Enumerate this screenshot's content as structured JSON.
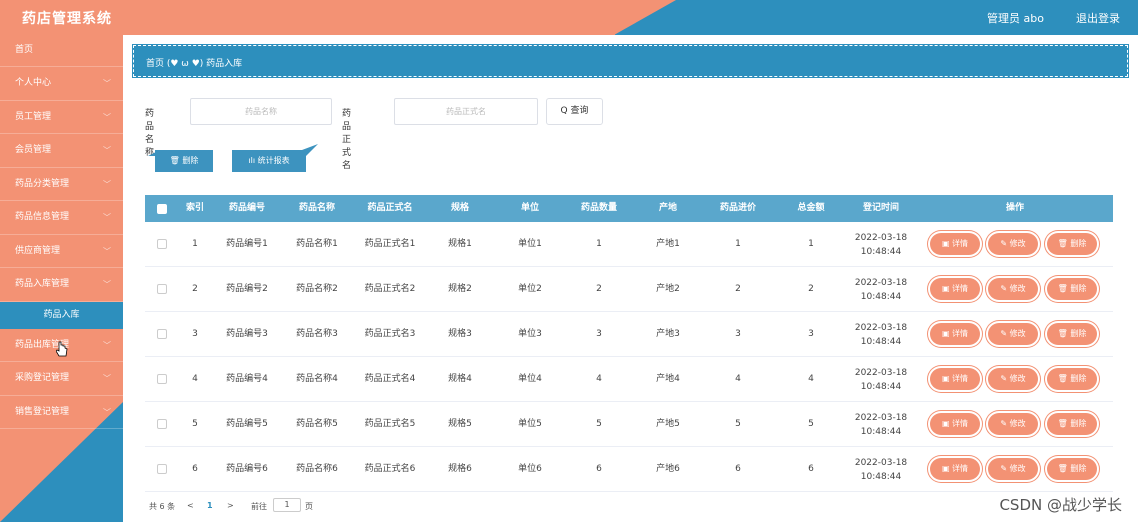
{
  "header": {
    "title": "药店管理系统",
    "user_label": "管理员 abo",
    "logout_label": "退出登录"
  },
  "sidebar": {
    "items": [
      {
        "label": "首页",
        "chevron": false
      },
      {
        "label": "个人中心",
        "chevron": true
      },
      {
        "label": "员工管理",
        "chevron": true
      },
      {
        "label": "会员管理",
        "chevron": true
      },
      {
        "label": "药品分类管理",
        "chevron": true
      },
      {
        "label": "药品信息管理",
        "chevron": true
      },
      {
        "label": "供应商管理",
        "chevron": true
      },
      {
        "label": "药品入库管理",
        "chevron": true
      },
      {
        "label": "药品入库",
        "sub": true
      },
      {
        "label": "药品出库管理",
        "chevron": true
      },
      {
        "label": "采购登记管理",
        "chevron": true
      },
      {
        "label": "销售登记管理",
        "chevron": true
      }
    ],
    "chevron_glyph": "﹀"
  },
  "breadcrumb": "首页 (♥ ω ♥) 药品入库",
  "search": {
    "name_label": "药品名称",
    "name_placeholder": "药品名称",
    "formal_label": "药品正式名",
    "formal_placeholder": "药品正式名",
    "query_label": "Q 查询"
  },
  "actions": {
    "delete_label": "🗑 删除",
    "report_label": "ılı 统计报表"
  },
  "table": {
    "headers": [
      "索引",
      "药品编号",
      "药品名称",
      "药品正式名",
      "规格",
      "单位",
      "药品数量",
      "产地",
      "药品进价",
      "总金额",
      "登记时间",
      "操作"
    ],
    "rows": [
      {
        "idx": "1",
        "code": "药品编号1",
        "name": "药品名称1",
        "formal": "药品正式名1",
        "spec": "规格1",
        "unit": "单位1",
        "qty": "1",
        "origin": "产地1",
        "price": "1",
        "total": "1",
        "date": "2022-03-18",
        "time": "10:48:44"
      },
      {
        "idx": "2",
        "code": "药品编号2",
        "name": "药品名称2",
        "formal": "药品正式名2",
        "spec": "规格2",
        "unit": "单位2",
        "qty": "2",
        "origin": "产地2",
        "price": "2",
        "total": "2",
        "date": "2022-03-18",
        "time": "10:48:44"
      },
      {
        "idx": "3",
        "code": "药品编号3",
        "name": "药品名称3",
        "formal": "药品正式名3",
        "spec": "规格3",
        "unit": "单位3",
        "qty": "3",
        "origin": "产地3",
        "price": "3",
        "total": "3",
        "date": "2022-03-18",
        "time": "10:48:44"
      },
      {
        "idx": "4",
        "code": "药品编号4",
        "name": "药品名称4",
        "formal": "药品正式名4",
        "spec": "规格4",
        "unit": "单位4",
        "qty": "4",
        "origin": "产地4",
        "price": "4",
        "total": "4",
        "date": "2022-03-18",
        "time": "10:48:44"
      },
      {
        "idx": "5",
        "code": "药品编号5",
        "name": "药品名称5",
        "formal": "药品正式名5",
        "spec": "规格5",
        "unit": "单位5",
        "qty": "5",
        "origin": "产地5",
        "price": "5",
        "total": "5",
        "date": "2022-03-18",
        "time": "10:48:44"
      },
      {
        "idx": "6",
        "code": "药品编号6",
        "name": "药品名称6",
        "formal": "药品正式名6",
        "spec": "规格6",
        "unit": "单位6",
        "qty": "6",
        "origin": "产地6",
        "price": "6",
        "total": "6",
        "date": "2022-03-18",
        "time": "10:48:44"
      }
    ],
    "op_detail": "▣ 详情",
    "op_edit": "✎ 修改",
    "op_delete": "🗑 删除"
  },
  "pagination": {
    "total_text": "共 6 条",
    "prev": "<",
    "current": "1",
    "next": ">",
    "goto_label": "前往",
    "goto_value": "1",
    "page_suffix": "页"
  },
  "watermark": "CSDN @战少学长",
  "colors": {
    "salmon": "#f39274",
    "blue": "#2d8fbd",
    "header_row": "#5aa7cc"
  }
}
